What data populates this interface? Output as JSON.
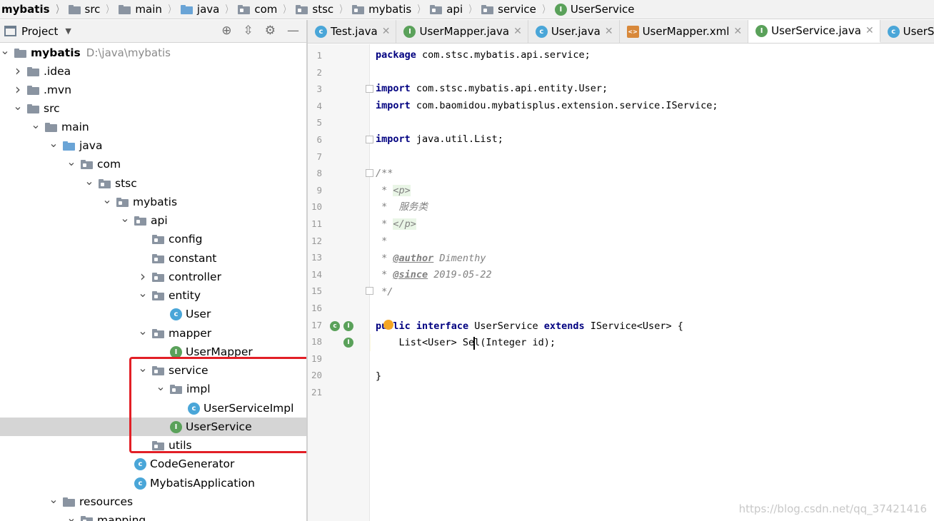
{
  "breadcrumb": [
    "mybatis",
    "src",
    "main",
    "java",
    "com",
    "stsc",
    "mybatis",
    "api",
    "service",
    "UserService"
  ],
  "project_panel": {
    "title": "Project",
    "tree": [
      {
        "label": "mybatis",
        "hint": "D:\\java\\mybatis",
        "arrow": "down",
        "icon": "module-folder"
      },
      {
        "label": ".idea",
        "arrow": "right",
        "icon": "folder"
      },
      {
        "label": ".mvn",
        "arrow": "right",
        "icon": "folder"
      },
      {
        "label": "src",
        "arrow": "down",
        "icon": "folder"
      },
      {
        "label": "main",
        "arrow": "down",
        "icon": "folder"
      },
      {
        "label": "java",
        "arrow": "down",
        "icon": "source-folder"
      },
      {
        "label": "com",
        "arrow": "down",
        "icon": "package"
      },
      {
        "label": "stsc",
        "arrow": "down",
        "icon": "package"
      },
      {
        "label": "mybatis",
        "arrow": "down",
        "icon": "package"
      },
      {
        "label": "api",
        "arrow": "down",
        "icon": "package"
      },
      {
        "label": "config",
        "arrow": "none",
        "icon": "package"
      },
      {
        "label": "constant",
        "arrow": "none",
        "icon": "package"
      },
      {
        "label": "controller",
        "arrow": "right",
        "icon": "package"
      },
      {
        "label": "entity",
        "arrow": "down",
        "icon": "package"
      },
      {
        "label": "User",
        "arrow": "none",
        "icon": "class"
      },
      {
        "label": "mapper",
        "arrow": "down",
        "icon": "package"
      },
      {
        "label": "UserMapper",
        "arrow": "none",
        "icon": "interface"
      },
      {
        "label": "service",
        "arrow": "down",
        "icon": "package"
      },
      {
        "label": "impl",
        "arrow": "down",
        "icon": "package"
      },
      {
        "label": "UserServiceImpl",
        "arrow": "none",
        "icon": "class"
      },
      {
        "label": "UserService",
        "arrow": "none",
        "icon": "interface",
        "selected": true
      },
      {
        "label": "utils",
        "arrow": "none",
        "icon": "package"
      },
      {
        "label": "CodeGenerator",
        "arrow": "none",
        "icon": "class-runnable"
      },
      {
        "label": "MybatisApplication",
        "arrow": "none",
        "icon": "spring-app"
      },
      {
        "label": "resources",
        "arrow": "down",
        "icon": "resources-folder"
      },
      {
        "label": "mapping",
        "arrow": "down",
        "icon": "package"
      }
    ]
  },
  "tabs": [
    {
      "label": "Test.java",
      "icon": "class"
    },
    {
      "label": "UserMapper.java",
      "icon": "interface"
    },
    {
      "label": "User.java",
      "icon": "class"
    },
    {
      "label": "UserMapper.xml",
      "icon": "xml"
    },
    {
      "label": "UserService.java",
      "icon": "interface",
      "active": true
    },
    {
      "label": "UserSer",
      "icon": "class"
    }
  ],
  "editor": {
    "line_numbers": [
      "1",
      "2",
      "3",
      "4",
      "5",
      "6",
      "7",
      "8",
      "9",
      "10",
      "11",
      "12",
      "13",
      "14",
      "15",
      "16",
      "17",
      "18",
      "19",
      "20",
      "21"
    ],
    "code": {
      "l1_kw": "package",
      "l1_rest": " com.stsc.mybatis.api.service;",
      "l3_kw": "import",
      "l3_rest": " com.stsc.mybatis.api.entity.User;",
      "l4_kw": "import",
      "l4_rest": " com.baomidou.mybatisplus.extension.service.IService;",
      "l6_kw": "import",
      "l6_rest": " java.util.List;",
      "l8": "/**",
      "l9_a": " * ",
      "l9_tag": "<p>",
      "l10": " *  服务类",
      "l11_a": " * ",
      "l11_tag": "</p>",
      "l12": " *",
      "l13_a": " * ",
      "l13_tag": "@author",
      "l13_b": " Dimenthy",
      "l14_a": " * ",
      "l14_tag": "@since",
      "l14_b": " 2019-05-22",
      "l15": " */",
      "l17_kw1": "public",
      "l17_kw2": "interface",
      "l17_name": " UserService ",
      "l17_kw3": "extends",
      "l17_rest": " IService<User> {",
      "l18": "    List<User> Sel(Integer id);",
      "l20": "}"
    }
  },
  "watermark": "https://blog.csdn.net/qq_37421416"
}
